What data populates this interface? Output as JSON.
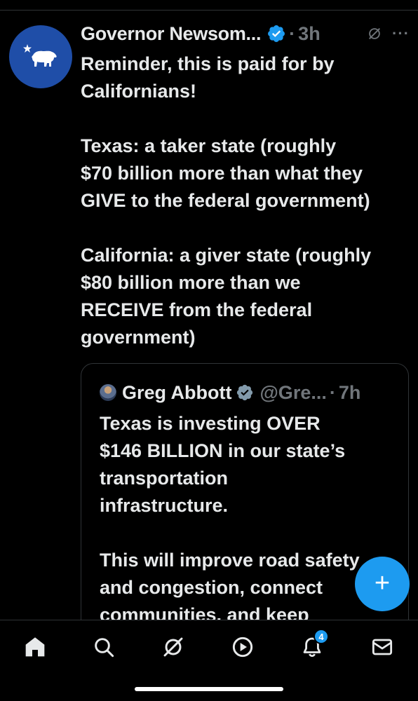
{
  "tweet": {
    "author": "Governor Newsom...",
    "separator": "·",
    "time": "3h",
    "avatar_icon": "california-bear-icon",
    "paragraphs": [
      [
        "Reminder, this is paid for by",
        "Californians!"
      ],
      [
        "Texas: a taker state (roughly",
        "$70 billion more than what they",
        "GIVE to the federal government)"
      ],
      [
        "California: a giver state (roughly",
        "$80 billion more than we",
        "RECEIVE from the federal",
        "government)"
      ]
    ]
  },
  "quote": {
    "author": "Greg Abbott",
    "handle": "@Gre...",
    "separator": "·",
    "time": "7h",
    "lines_para1": [
      "Texas is investing OVER",
      "$146 BILLION in our state’s",
      "transportation",
      "infrastructure."
    ],
    "lines_para2": [
      "This will improve road safety",
      "and congestion, connect",
      "communities, and keep"
    ]
  },
  "fab": {
    "label": "+",
    "icon": "compose-plus-icon"
  },
  "nav": {
    "items": [
      "home-icon",
      "search-icon",
      "grok-icon",
      "play-icon",
      "bell-icon",
      "mail-icon"
    ],
    "notifications_badge": "4"
  },
  "colors": {
    "accent": "#1d9bf0",
    "text": "#e7e9ea",
    "muted": "#71767b",
    "background": "#000000",
    "avatar_bg": "#1f4ea8"
  }
}
